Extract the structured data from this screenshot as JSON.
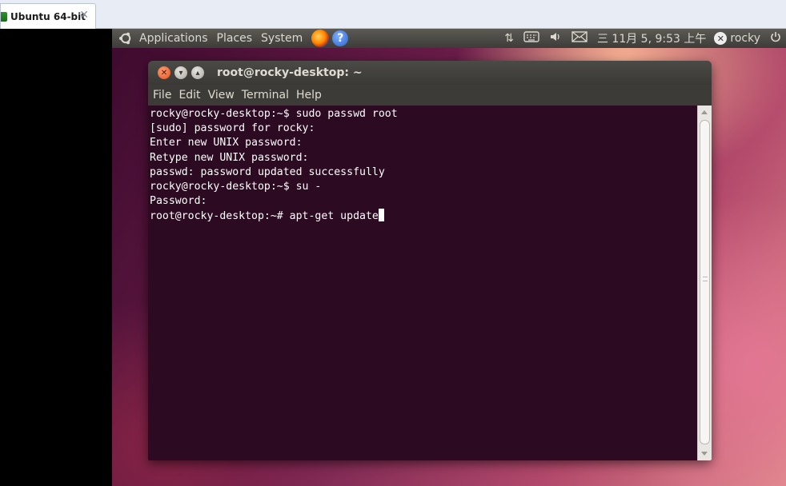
{
  "host": {
    "tab_label": "Ubuntu 64-bit",
    "close_glyph": "✕"
  },
  "panel": {
    "menus": [
      "Applications",
      "Places",
      "System"
    ],
    "help_glyph": "?",
    "clock": "三 11月  5, 9:53 上午",
    "user": "rocky",
    "icons": [
      "ubuntu-logo-icon",
      "firefox-icon",
      "help-icon",
      "network-icon",
      "keyboard-icon",
      "volume-icon",
      "mail-icon",
      "user-status-icon",
      "power-icon"
    ]
  },
  "terminal": {
    "title": "root@rocky-desktop: ~",
    "menu": [
      "File",
      "Edit",
      "View",
      "Terminal",
      "Help"
    ],
    "lines": [
      "rocky@rocky-desktop:~$ sudo passwd root",
      "[sudo] password for rocky:",
      "Enter new UNIX password:",
      "Retype new UNIX password:",
      "passwd: password updated successfully",
      "rocky@rocky-desktop:~$ su -",
      "Password:",
      "root@rocky-desktop:~# apt-get update"
    ]
  },
  "colors": {
    "terminal_bg": "#2c0a22",
    "panel_bg": "#3d3c38",
    "close_button": "#e2531f"
  }
}
